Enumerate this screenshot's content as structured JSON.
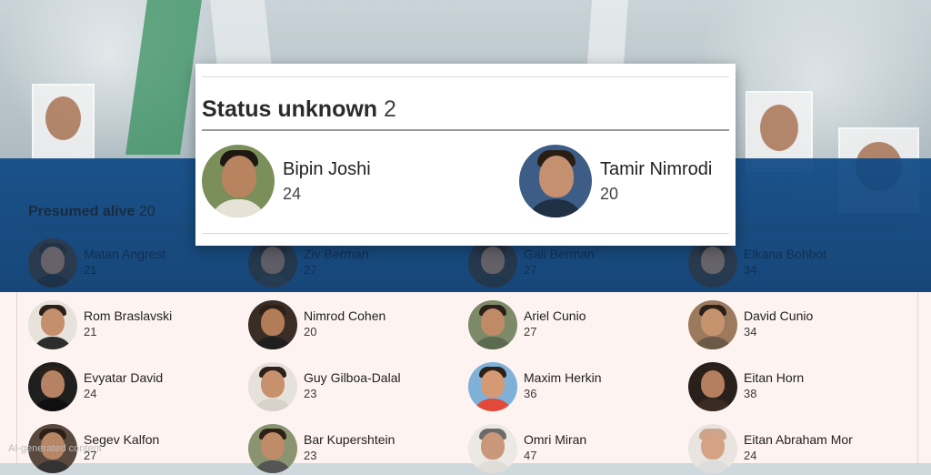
{
  "status_unknown": {
    "title": "Status unknown",
    "count": "2",
    "people": [
      {
        "name": "Bipin Joshi",
        "age": "24"
      },
      {
        "name": "Tamir Nimrodi",
        "age": "20"
      }
    ]
  },
  "presumed_alive": {
    "title": "Presumed alive",
    "count": "20",
    "people": [
      {
        "name": "Matan Angrest",
        "age": "21"
      },
      {
        "name": "Ziv Berman",
        "age": "27"
      },
      {
        "name": "Gali Berman",
        "age": "27"
      },
      {
        "name": "Elkana Bohbot",
        "age": "34"
      },
      {
        "name": "Rom Braslavski",
        "age": "21"
      },
      {
        "name": "Nimrod Cohen",
        "age": "20"
      },
      {
        "name": "Ariel Cunio",
        "age": "27"
      },
      {
        "name": "David Cunio",
        "age": "34"
      },
      {
        "name": "Evyatar David",
        "age": "24"
      },
      {
        "name": "Guy Gilboa-Dalal",
        "age": "23"
      },
      {
        "name": "Maxim Herkin",
        "age": "36"
      },
      {
        "name": "Eitan Horn",
        "age": "38"
      },
      {
        "name": "Segev Kalfon",
        "age": "27"
      },
      {
        "name": "Bar Kupershtein",
        "age": "23"
      },
      {
        "name": "Omri Miran",
        "age": "47"
      },
      {
        "name": "Eitan Abraham Mor",
        "age": "24"
      }
    ]
  },
  "watermark": "AI-generated content",
  "colors": {
    "band_blue": "#0f4a86",
    "lower_background": "#fdf3f1",
    "card_background": "#ffffff"
  }
}
